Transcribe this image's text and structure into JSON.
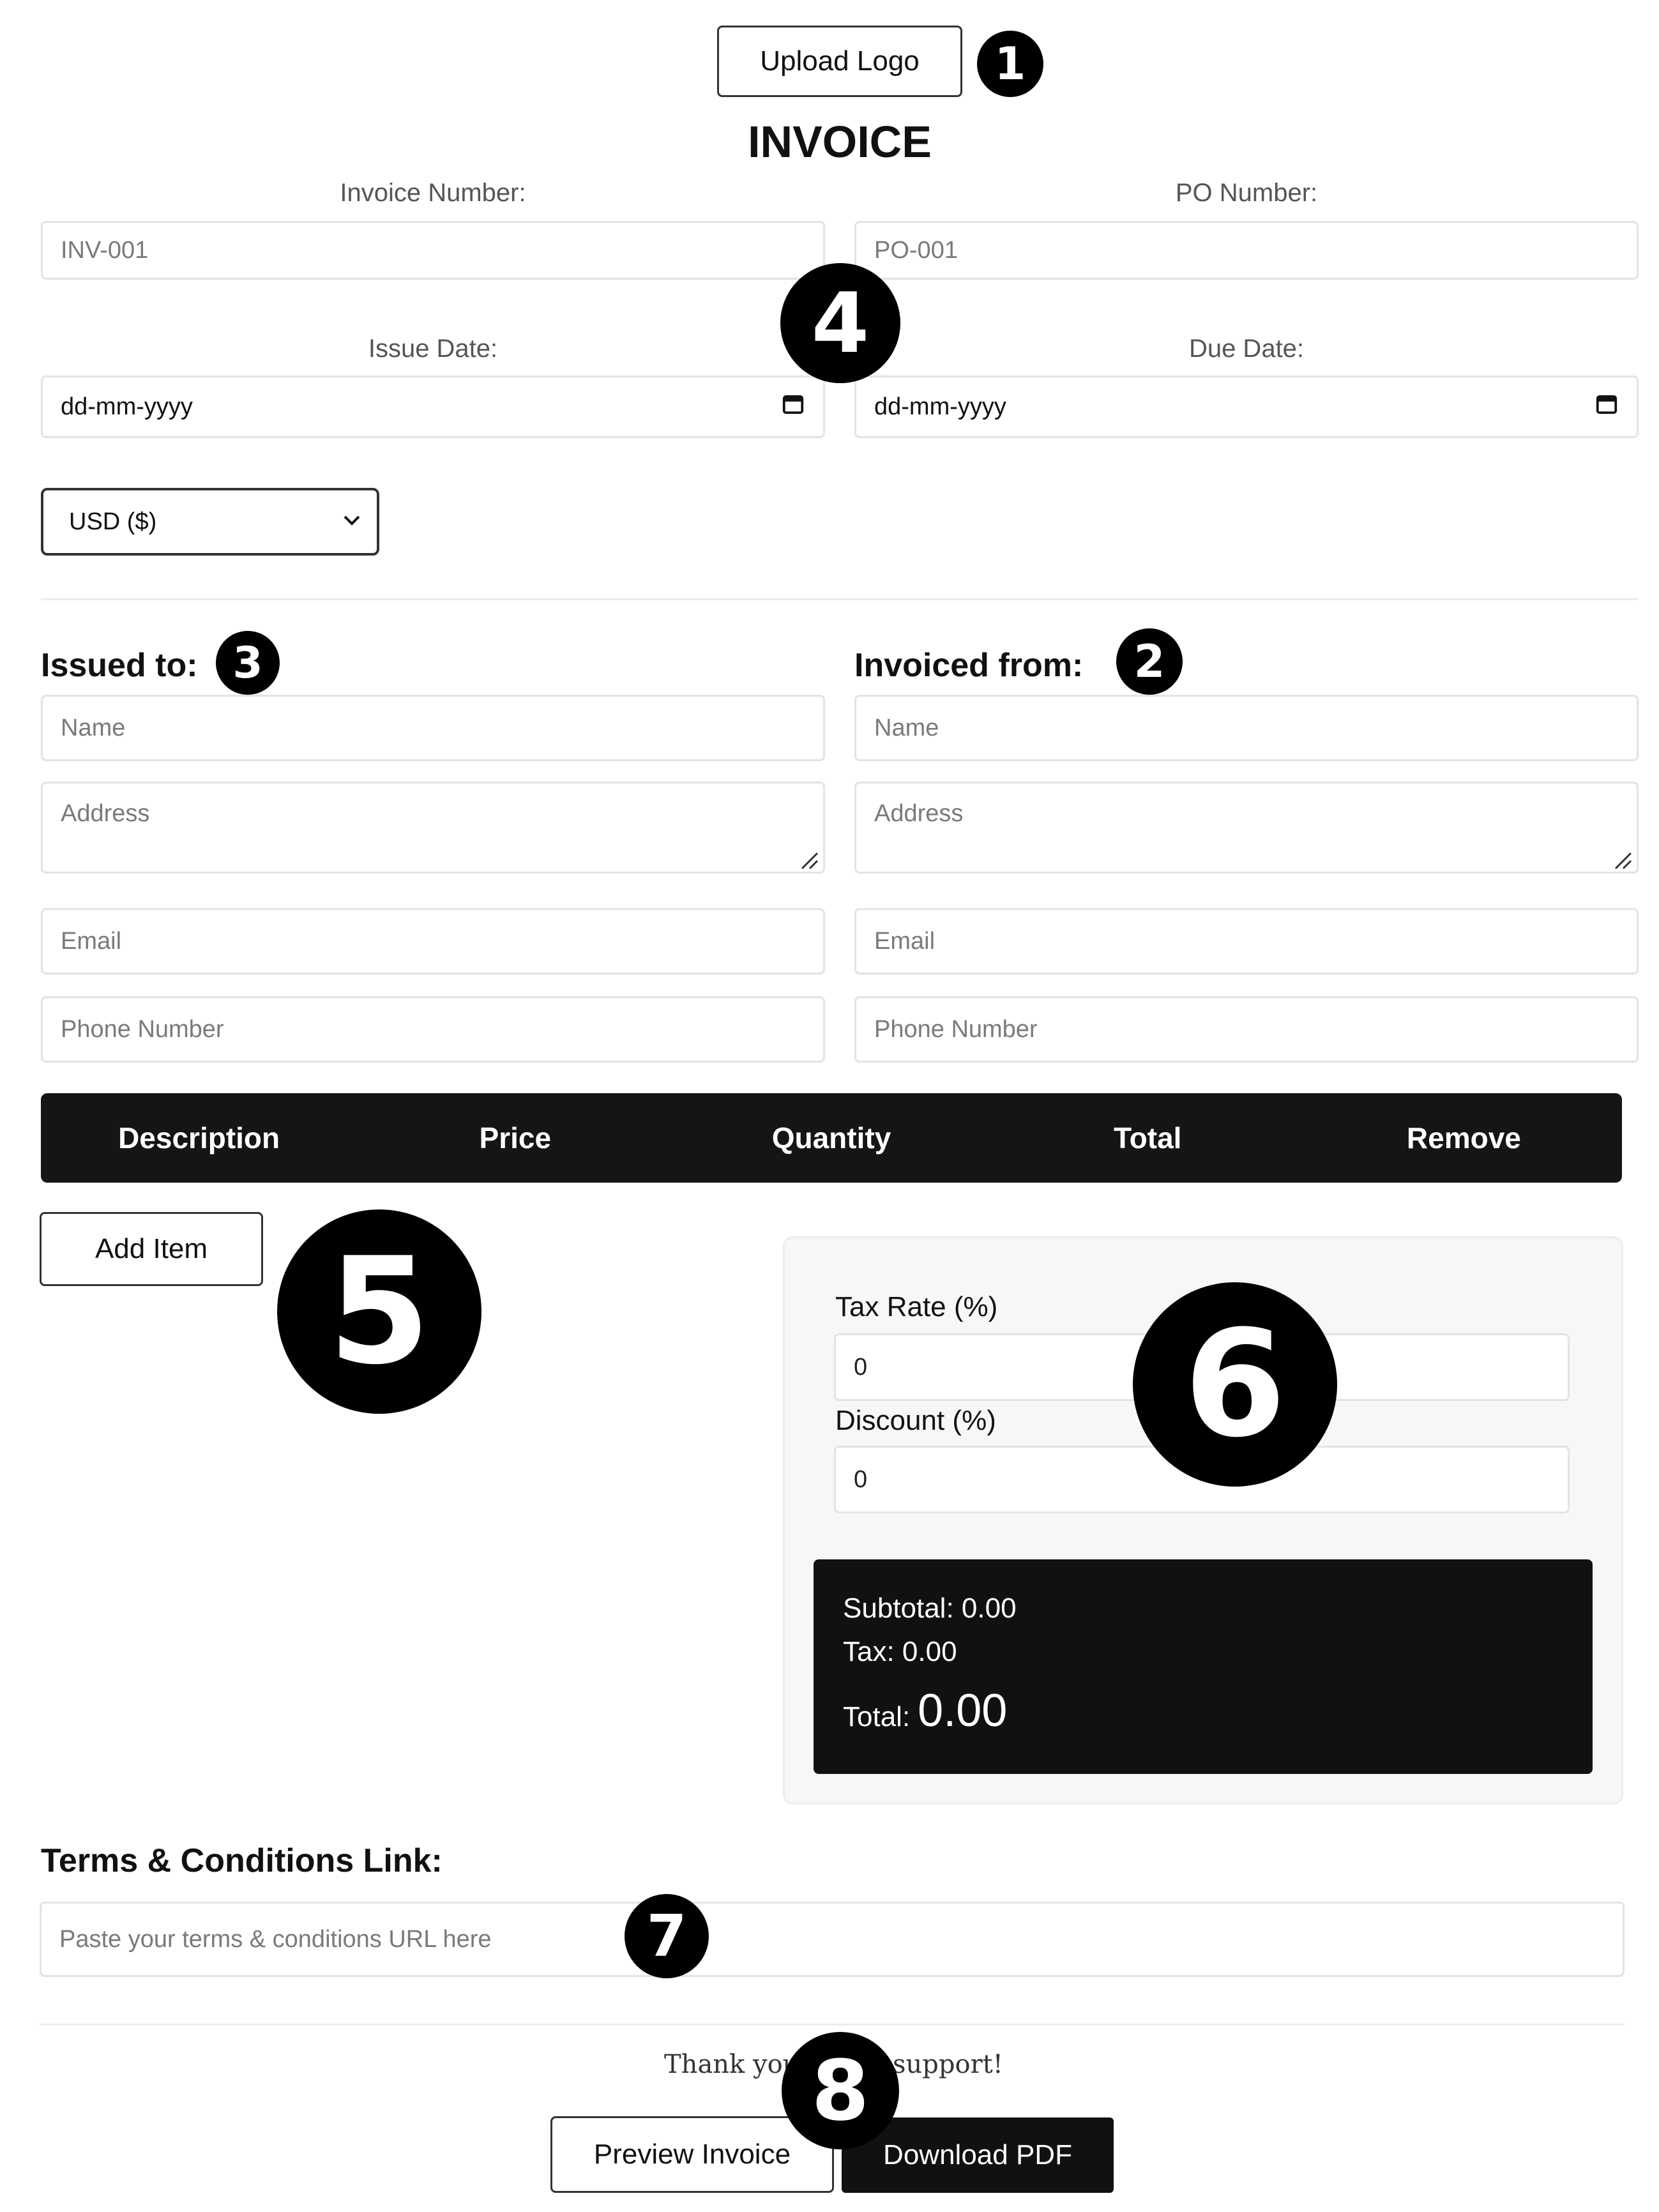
{
  "header": {
    "upload_logo_label": "Upload Logo",
    "title": "INVOICE"
  },
  "invoice_meta": {
    "invoice_number_label": "Invoice Number:",
    "invoice_number_placeholder": "INV-001",
    "po_number_label": "PO Number:",
    "po_number_placeholder": "PO-001",
    "issue_date_label": "Issue Date:",
    "issue_date_value": "dd-mm-yyyy",
    "due_date_label": "Due Date:",
    "due_date_value": "dd-mm-yyyy",
    "currency_selected": "USD ($)"
  },
  "issued_to": {
    "title": "Issued to:",
    "name_placeholder": "Name",
    "address_placeholder": "Address",
    "email_placeholder": "Email",
    "phone_placeholder": "Phone Number"
  },
  "invoiced_from": {
    "title": "Invoiced from:",
    "name_placeholder": "Name",
    "address_placeholder": "Address",
    "email_placeholder": "Email",
    "phone_placeholder": "Phone Number"
  },
  "items_table": {
    "columns": [
      "Description",
      "Price",
      "Quantity",
      "Total",
      "Remove"
    ],
    "add_item_label": "Add Item"
  },
  "summary": {
    "tax_rate_label": "Tax Rate (%)",
    "tax_rate_value": "0",
    "discount_label": "Discount (%)",
    "discount_value": "0",
    "subtotal_text": "Subtotal: 0.00",
    "tax_text": "Tax: 0.00",
    "total_label": "Total:",
    "total_value": "0.00"
  },
  "terms": {
    "title": "Terms & Conditions Link:",
    "placeholder": "Paste your terms & conditions URL here"
  },
  "footer": {
    "thank_you_left": "Thank you",
    "thank_you_right": "support!",
    "preview_label": "Preview Invoice",
    "download_label": "Download PDF"
  },
  "markers": [
    "1",
    "2",
    "3",
    "4",
    "5",
    "6",
    "7",
    "8"
  ],
  "icons": {
    "calendar": "calendar-icon",
    "chevron": "chevron-down-icon",
    "resize": "resize-grip-icon"
  }
}
